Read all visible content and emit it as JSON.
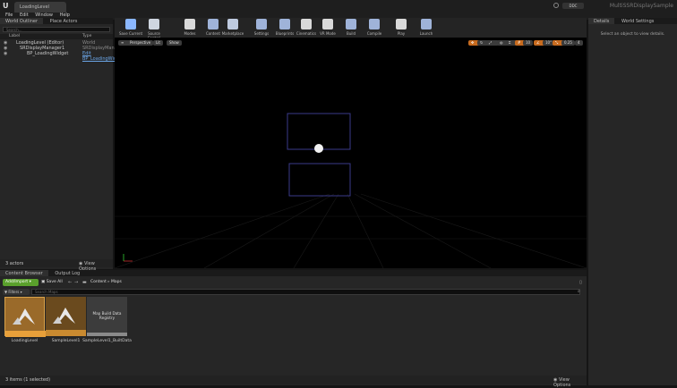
{
  "titlebar": {
    "doc_tab": "LoadingLevel",
    "project_name": "MultiSSRDisplaySample",
    "badge": "DDC"
  },
  "menu": [
    "File",
    "Edit",
    "Window",
    "Help"
  ],
  "outliner": {
    "tabs": [
      "World Outliner",
      "Place Actors"
    ],
    "search_placeholder": "Search...",
    "col_label": "Label",
    "col_type": "Type",
    "rows": [
      {
        "label": "LoadingLevel (Editor)",
        "type": "World"
      },
      {
        "label": "SRDisplayManager1",
        "type": "SRDisplayManager"
      },
      {
        "label": "BP_LoadingWidget",
        "type": "Edit BP_LoadingWidget"
      }
    ],
    "footer_count": "3 actors",
    "view_options": "View Options"
  },
  "toolbar": [
    {
      "label": "Save Current",
      "color": "#8bb7ff"
    },
    {
      "label": "Source Control",
      "color": "#cfd6e0"
    },
    {
      "label": "Modes",
      "color": "#d9d9d9"
    },
    {
      "label": "Content",
      "color": "#9fb3d9"
    },
    {
      "label": "Marketplace",
      "color": "#bfcbe0"
    },
    {
      "label": "Settings",
      "color": "#9fb3d9"
    },
    {
      "label": "Blueprints",
      "color": "#9fb3d9"
    },
    {
      "label": "Cinematics",
      "color": "#d9d9d9"
    },
    {
      "label": "VR Mode",
      "color": "#d9d9d9"
    },
    {
      "label": "Build",
      "color": "#9fb3d9"
    },
    {
      "label": "Compile",
      "color": "#9fb3d9"
    },
    {
      "label": "Play",
      "color": "#d9d9d9"
    },
    {
      "label": "Launch",
      "color": "#9fb3d9"
    }
  ],
  "viewport": {
    "perspective": "Perspective",
    "lit": "Lit",
    "show": "Show",
    "grid_snap": "10",
    "rot_snap": "10°",
    "scale_snap": "0.25",
    "cam_speed": "4"
  },
  "details": {
    "tabs": [
      "Details",
      "World Settings"
    ],
    "empty_text": "Select an object to view details."
  },
  "content_browser": {
    "tabs": [
      "Content Browser",
      "Output Log"
    ],
    "add_import": "Add/Import",
    "save_all": "Save All",
    "path": [
      "Content",
      "Maps"
    ],
    "filters": "Filters",
    "search_placeholder": "Search Maps",
    "assets": [
      {
        "name": "LoadingLevel",
        "kind": "map",
        "selected": true
      },
      {
        "name": "SampleLevel1",
        "kind": "map",
        "selected": false
      },
      {
        "name": "SampleLevel1_BuiltData",
        "kind": "data",
        "thumb_text": "Map Build Data Registry",
        "selected": false
      }
    ],
    "footer_count": "3 items (1 selected)",
    "view_options": "View Options"
  },
  "colors": {
    "accent_orange": "#c76b1f",
    "accent_green": "#5aa02c",
    "panel": "#262626",
    "viewport": "#000000"
  }
}
